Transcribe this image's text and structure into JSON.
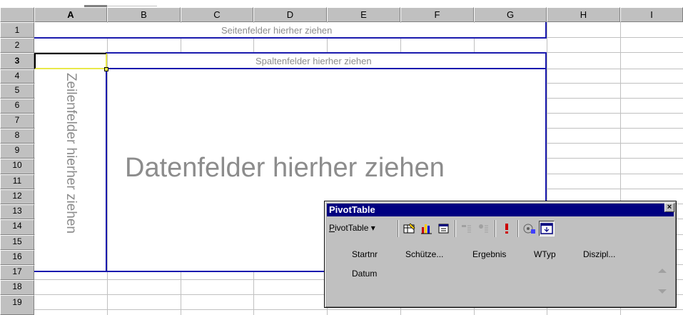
{
  "columns": [
    "A",
    "B",
    "C",
    "D",
    "E",
    "F",
    "G",
    "H",
    "I"
  ],
  "selected_column": "A",
  "rows": [
    "1",
    "2",
    "3",
    "4",
    "5",
    "6",
    "7",
    "8",
    "9",
    "10",
    "11",
    "12",
    "13",
    "14",
    "15",
    "16",
    "17",
    "18",
    "19"
  ],
  "selected_row": "3",
  "pivot": {
    "page_fields_hint": "Seitenfelder hierher ziehen",
    "column_fields_hint": "Spaltenfelder hierher ziehen",
    "row_fields_hint": "Zeilenfelder hierher ziehen",
    "data_fields_hint": "Datenfelder hierher ziehen"
  },
  "toolbar": {
    "title": "PivotTable",
    "close_label": "×",
    "menu_label": "PivotTable",
    "menu_accel": "P",
    "menu_rest": "ivotTable",
    "menu_arrow": "▾",
    "buttons": [
      "chart-wizard-icon",
      "pivot-chart-icon",
      "table-wizard-icon",
      "hide-detail-icon",
      "show-detail-icon",
      "refresh-icon",
      "field-settings-icon",
      "show-fields-icon"
    ],
    "fields": [
      "Startnr",
      "Schütze...",
      "Ergebnis",
      "WTyp",
      "Diszipl...",
      "Datum"
    ]
  },
  "colors": {
    "pivot_outline": "#1a1aae",
    "title_bar": "#000080",
    "hint_text": "#8c8c8c",
    "chrome": "#c0c0c0"
  }
}
